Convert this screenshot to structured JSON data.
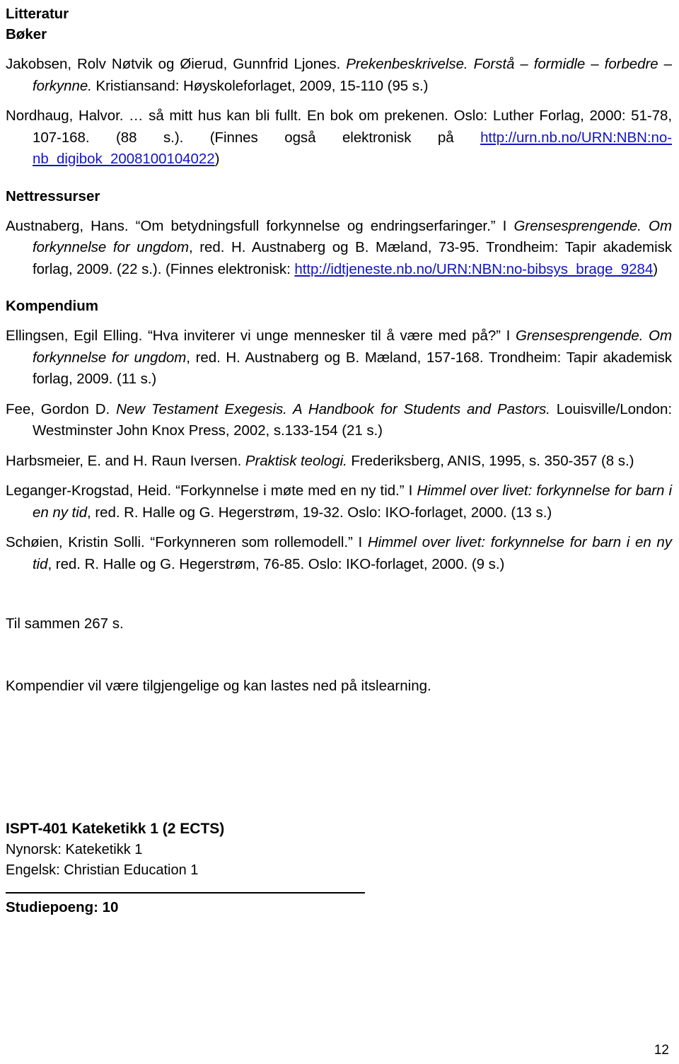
{
  "document": {
    "page_number": "12",
    "link_color": "#1414c8",
    "headings": {
      "litteratur": "Litteratur",
      "boker": "Bøker",
      "nettressurser": "Nettressurser",
      "kompendium": "Kompendium"
    },
    "boker": [
      {
        "id": "jakobsen",
        "parts": [
          {
            "text": "Jakobsen, Rolv Nøtvik og Øierud, Gunnfrid Ljones. ",
            "style": "normal"
          },
          {
            "text": "Prekenbeskrivelse. Forstå – formidle – forbedre – forkynne.",
            "style": "italic"
          },
          {
            "text": " Kristiansand: Høyskoleforlaget, 2009, 15-110 (95 s.)",
            "style": "normal"
          }
        ]
      },
      {
        "id": "nordhaug",
        "parts": [
          {
            "text": "Nordhaug, Halvor. … så mitt hus kan bli fullt. En bok om prekenen. Oslo: Luther Forlag, 2000: 51-78, 107-168. (88 s.). (Finnes også elektronisk på ",
            "style": "normal"
          },
          {
            "text": "http://urn.nb.no/URN:NBN:no-nb_digibok_2008100104022",
            "style": "link"
          },
          {
            "text": ")",
            "style": "normal"
          }
        ]
      }
    ],
    "nettressurser": [
      {
        "id": "austnaberg",
        "parts": [
          {
            "text": "Austnaberg, Hans. “Om betydningsfull forkynnelse og endringserfaringer.” I ",
            "style": "normal"
          },
          {
            "text": "Grensesprengende. Om forkynnelse for ungdom",
            "style": "italic"
          },
          {
            "text": ", red. H. Austnaberg og B. Mæland, 73-95. Trondheim: Tapir akademisk forlag, 2009. (22 s.). (Finnes elektronisk: ",
            "style": "normal"
          },
          {
            "text": "http://idtjeneste.nb.no/URN:NBN:no-bibsys_brage_9284",
            "style": "link"
          },
          {
            "text": ")",
            "style": "normal"
          }
        ]
      }
    ],
    "kompendium": [
      {
        "id": "ellingsen",
        "parts": [
          {
            "text": "Ellingsen, Egil Elling. “Hva inviterer vi unge mennesker til å være med på?” I ",
            "style": "normal"
          },
          {
            "text": "Grensesprengende. Om forkynnelse for ungdom",
            "style": "italic"
          },
          {
            "text": ", red. H. Austnaberg og B. Mæland, 157-168. Trondheim: Tapir akademisk forlag, 2009. (11 s.)",
            "style": "normal"
          }
        ]
      },
      {
        "id": "fee",
        "parts": [
          {
            "text": "Fee, Gordon D. ",
            "style": "normal"
          },
          {
            "text": "New Testament Exegesis. A Handbook for Students and Pastors.",
            "style": "italic"
          },
          {
            "text": " Louisville/London: Westminster John Knox Press, 2002, s.133-154 (21 s.)",
            "style": "normal"
          }
        ]
      },
      {
        "id": "harbsmeier",
        "parts": [
          {
            "text": "Harbsmeier, E. and H. Raun Iversen. ",
            "style": "normal"
          },
          {
            "text": "Praktisk teologi.",
            "style": "italic"
          },
          {
            "text": " Frederiksberg, ANIS, 1995, s. 350-357 (8 s.)",
            "style": "normal"
          }
        ]
      },
      {
        "id": "leganger-krogstad",
        "parts": [
          {
            "text": "Leganger-Krogstad, Heid. “Forkynnelse i møte med en ny tid.” I ",
            "style": "normal"
          },
          {
            "text": "Himmel over livet: forkynnelse for barn i en ny tid",
            "style": "italic"
          },
          {
            "text": ", red. R. Halle og G. Hegerstrøm, 19-32. Oslo: IKO-forlaget, 2000. (13 s.)",
            "style": "normal"
          }
        ]
      },
      {
        "id": "schoien",
        "parts": [
          {
            "text": "Schøien, Kristin Solli. “Forkynneren som rollemodell.” I ",
            "style": "normal"
          },
          {
            "text": "Himmel over livet: forkynnelse for barn i en ny tid",
            "style": "italic"
          },
          {
            "text": ", red. R. Halle og G. Hegerstrøm, 76-85. Oslo: IKO-forlaget, 2000. (9 s.)",
            "style": "normal"
          }
        ]
      }
    ],
    "summary": {
      "total_pages": "Til sammen 267 s.",
      "note": "Kompendier vil være tilgjengelige og kan lastes ned på itslearning."
    },
    "course": {
      "title": "ISPT-401 Kateketikk 1 (2 ECTS)",
      "nynorsk": "Nynorsk: Kateketikk 1",
      "engelsk": "Engelsk: Christian Education 1",
      "studiepoeng": "Studiepoeng: 10"
    }
  }
}
